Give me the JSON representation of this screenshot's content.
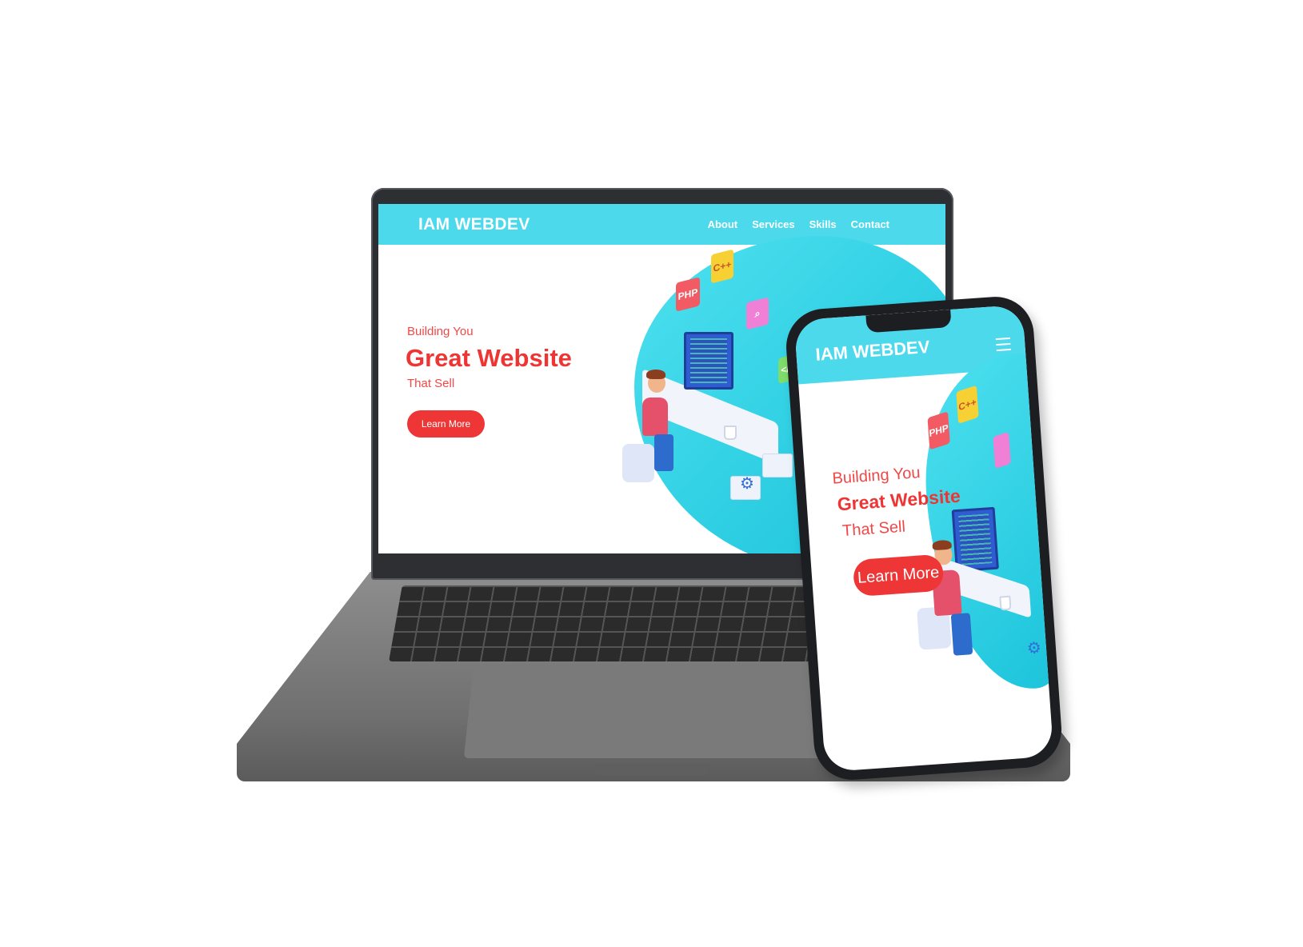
{
  "desktop": {
    "logo": "IAM WEBDEV",
    "nav": [
      "About",
      "Services",
      "Skills",
      "Contact"
    ],
    "hero": {
      "kicker": "Building You",
      "headline": "Great Website",
      "sub": "That Sell",
      "button": "Learn More"
    },
    "illustration": {
      "cubes": [
        "PHP",
        "C++"
      ]
    }
  },
  "mobile": {
    "logo": "IAM WEBDEV",
    "menu_icon": "hamburger-menu-icon",
    "hero": {
      "kicker": "Building You",
      "headline": "Great Website",
      "sub": "That Sell",
      "button": "Learn More"
    },
    "illustration": {
      "cubes": [
        "PHP",
        "C++"
      ]
    }
  },
  "colors": {
    "nav_bg": "#4dd9ec",
    "accent": "#ef3434",
    "device_dark": "#1d1e22",
    "laptop_grey": "#7a7a7a"
  }
}
